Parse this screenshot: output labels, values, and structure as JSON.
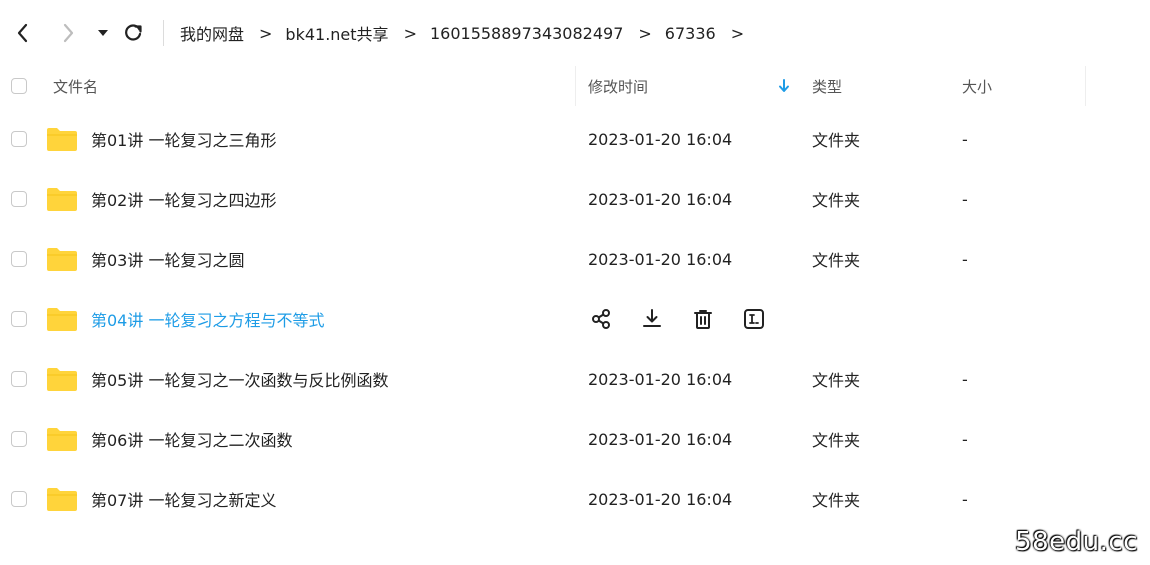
{
  "breadcrumb": [
    {
      "label": "我的网盘"
    },
    {
      "label": "bk41.net共享"
    },
    {
      "label": "1601558897343082497"
    },
    {
      "label": "67336"
    }
  ],
  "breadcrumb_separator": ">",
  "columns": {
    "name": "文件名",
    "modified": "修改时间",
    "type": "类型",
    "size": "大小"
  },
  "rows": [
    {
      "name": "第01讲 一轮复习之三角形",
      "modified": "2023-01-20 16:04",
      "type": "文件夹",
      "size": "-"
    },
    {
      "name": "第02讲 一轮复习之四边形",
      "modified": "2023-01-20 16:04",
      "type": "文件夹",
      "size": "-"
    },
    {
      "name": "第03讲 一轮复习之圆",
      "modified": "2023-01-20 16:04",
      "type": "文件夹",
      "size": "-"
    },
    {
      "name": "第04讲 一轮复习之方程与不等式",
      "modified": "",
      "type": "",
      "size": ""
    },
    {
      "name": "第05讲 一轮复习之一次函数与反比例函数",
      "modified": "2023-01-20 16:04",
      "type": "文件夹",
      "size": "-"
    },
    {
      "name": "第06讲 一轮复习之二次函数",
      "modified": "2023-01-20 16:04",
      "type": "文件夹",
      "size": "-"
    },
    {
      "name": "第07讲 一轮复习之新定义",
      "modified": "2023-01-20 16:04",
      "type": "文件夹",
      "size": "-"
    }
  ],
  "hover_row_actions": [
    "share-icon",
    "download-icon",
    "delete-icon",
    "rename-icon"
  ],
  "colors": {
    "accent": "#1e9ce6",
    "folder": "#ffd43b",
    "text": "#222222"
  },
  "watermark": "58edu.cc"
}
